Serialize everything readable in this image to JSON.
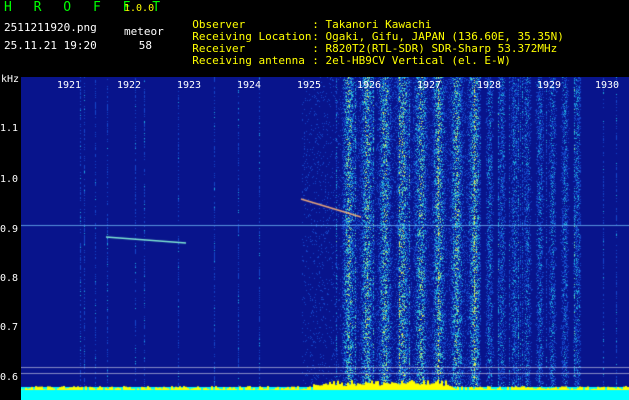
{
  "header": {
    "app_title": "H R O F F T",
    "app_version": "1.0.0",
    "file_name": "2511211920.png",
    "timestamp": "25.11.21 19:20",
    "detection_label": "meteor",
    "detection_count": "58"
  },
  "station_info": [
    {
      "label": "Observer",
      "value": ": Takanori Kawachi"
    },
    {
      "label": "Receiving Location",
      "value": ": Ogaki, Gifu, JAPAN (136.60E, 35.35N)"
    },
    {
      "label": "Receiver",
      "value": ": R820T2(RTL-SDR) SDR-Sharp 53.372MHz"
    },
    {
      "label": "Receiving antenna",
      "value": ": 2el-HB9CV Vertical (el. E-W)"
    }
  ],
  "axes": {
    "unit_label": "kHz",
    "time_ticks": [
      "1921",
      "1922",
      "1923",
      "1924",
      "1925",
      "1926",
      "1927",
      "1928",
      "1929",
      "1930"
    ],
    "freq_ticks": [
      "1.1",
      "1.0",
      "0.9",
      "0.8",
      "0.7",
      "0.6"
    ]
  },
  "colors": {
    "background": "#000000",
    "title_green": "#00ff00",
    "info_yellow": "#ffff00",
    "noise_floor": "#0b1890",
    "baseline_cyan": "#00ffff"
  }
}
